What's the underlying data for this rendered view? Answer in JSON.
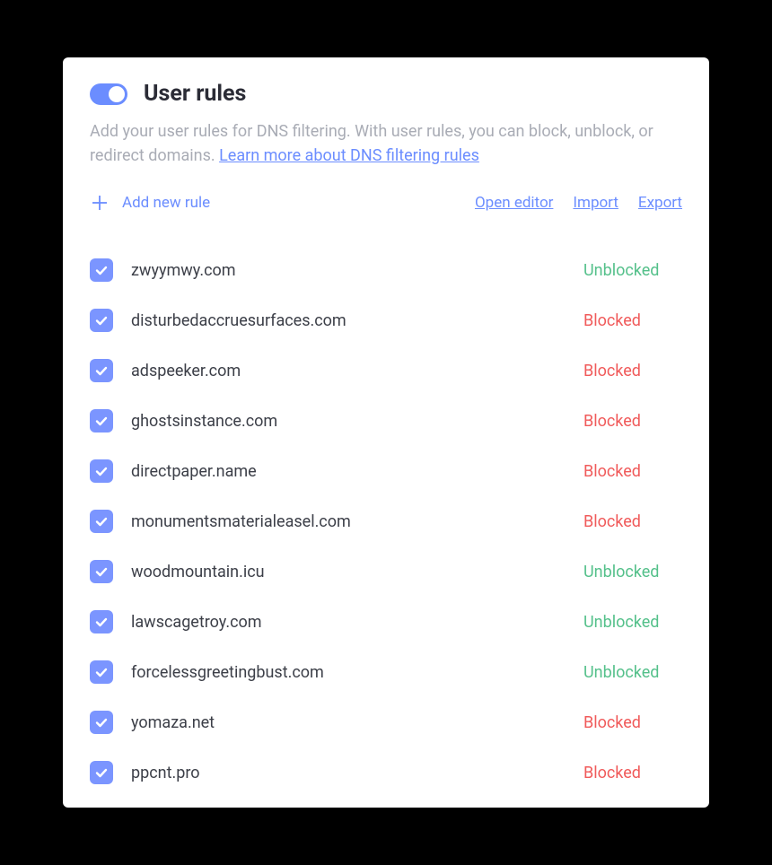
{
  "header": {
    "title": "User rules",
    "toggleOn": true
  },
  "description": {
    "text1": "Add your user rules for DNS filtering. With user rules, you can block, unblock, or redirect domains. ",
    "linkText": "Learn more about DNS filtering rules"
  },
  "actions": {
    "addRule": "Add new rule",
    "openEditor": "Open editor",
    "import": "Import",
    "export": "Export"
  },
  "statusLabels": {
    "blocked": "Blocked",
    "unblocked": "Unblocked"
  },
  "rules": [
    {
      "domain": "zwyymwy.com",
      "status": "unblocked",
      "checked": true
    },
    {
      "domain": "disturbedaccruesurfaces.com",
      "status": "blocked",
      "checked": true
    },
    {
      "domain": "adspeeker.com",
      "status": "blocked",
      "checked": true
    },
    {
      "domain": "ghostsinstance.com",
      "status": "blocked",
      "checked": true
    },
    {
      "domain": "directpaper.name",
      "status": "blocked",
      "checked": true
    },
    {
      "domain": "monumentsmaterialeasel.com",
      "status": "blocked",
      "checked": true
    },
    {
      "domain": "woodmountain.icu",
      "status": "unblocked",
      "checked": true
    },
    {
      "domain": "lawscagetroy.com",
      "status": "unblocked",
      "checked": true
    },
    {
      "domain": "forcelessgreetingbust.com",
      "status": "unblocked",
      "checked": true
    },
    {
      "domain": "yomaza.net",
      "status": "blocked",
      "checked": true
    },
    {
      "domain": "ppcnt.pro",
      "status": "blocked",
      "checked": true
    }
  ]
}
